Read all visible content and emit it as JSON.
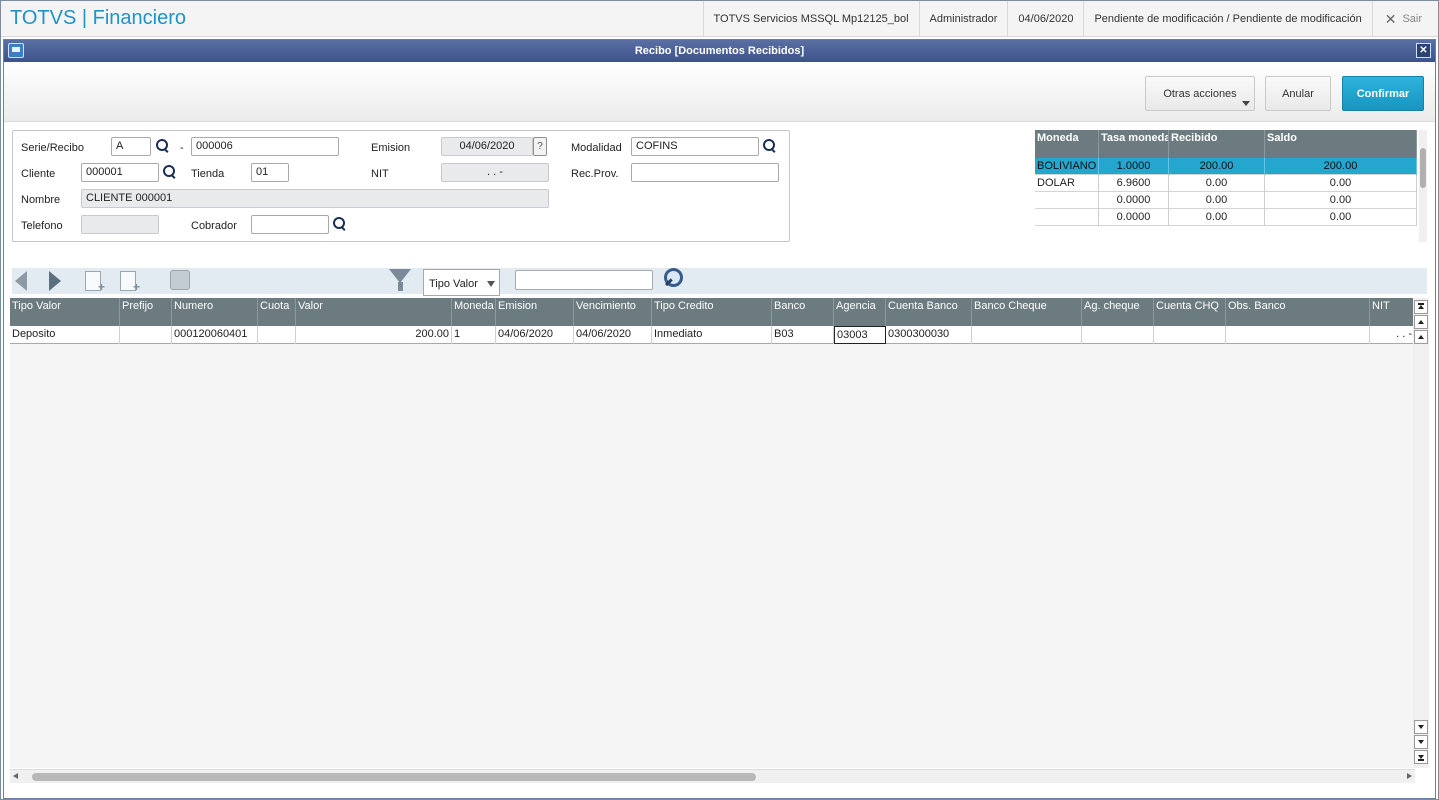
{
  "app": {
    "title": "TOTVS | Financiero",
    "environment": "TOTVS Servicios MSSQL Mp12125_bol",
    "user": "Administrador",
    "date": "04/06/2020",
    "status": "Pendiente de modificación / Pendiente de modificación",
    "exit_label": "Sair"
  },
  "dialog": {
    "title": "Recibo [Documentos Recibidos]",
    "buttons": {
      "otras": "Otras acciones",
      "anular": "Anular",
      "confirmar": "Confirmar"
    }
  },
  "form": {
    "serie_label": "Serie/Recibo",
    "serie_value": "A",
    "dash": "-",
    "recibo_value": "000006",
    "emision_label": "Emision",
    "emision_value": "04/06/2020",
    "help": "?",
    "modalidad_label": "Modalidad",
    "modalidad_value": "COFINS",
    "cliente_label": "Cliente",
    "cliente_value": "000001",
    "tienda_label": "Tienda",
    "tienda_value": "01",
    "nit_label": "NIT",
    "nit_value": ". . -",
    "recprov_label": "Rec.Prov.",
    "recprov_value": "",
    "nombre_label": "Nombre",
    "nombre_value": "CLIENTE 000001",
    "telefono_label": "Telefono",
    "telefono_value": "",
    "cobrador_label": "Cobrador",
    "cobrador_value": ""
  },
  "moneda_grid": {
    "headers": [
      "Moneda",
      "Tasa moneda",
      "Recibido",
      "Saldo"
    ],
    "rows": [
      [
        "BOLIVIANO",
        "1.0000",
        "200.00",
        "200.00"
      ],
      [
        "DOLAR",
        "6.9600",
        "0.00",
        "0.00"
      ],
      [
        "",
        "0.0000",
        "0.00",
        "0.00"
      ],
      [
        "",
        "0.0000",
        "0.00",
        "0.00"
      ]
    ]
  },
  "toolbar": {
    "filter_select": "Tipo Valor",
    "search_value": ""
  },
  "main_grid": {
    "headers": [
      "Tipo Valor",
      "Prefijo",
      "Numero",
      "Cuota",
      "Valor",
      "Moneda",
      "Emision",
      "Vencimiento",
      "Tipo Credito",
      "Banco",
      "Agencia",
      "Cuenta Banco",
      "Banco Cheque",
      "Ag. cheque",
      "Cuenta CHQ",
      "Obs. Banco",
      "NIT"
    ],
    "rows": [
      [
        "Deposito",
        "",
        "000120060401",
        "",
        "200.00",
        "1",
        "04/06/2020",
        "04/06/2020",
        "Inmediato",
        "B03",
        "03003",
        "0300300030",
        "",
        "",
        "",
        "",
        ". . -"
      ]
    ]
  }
}
